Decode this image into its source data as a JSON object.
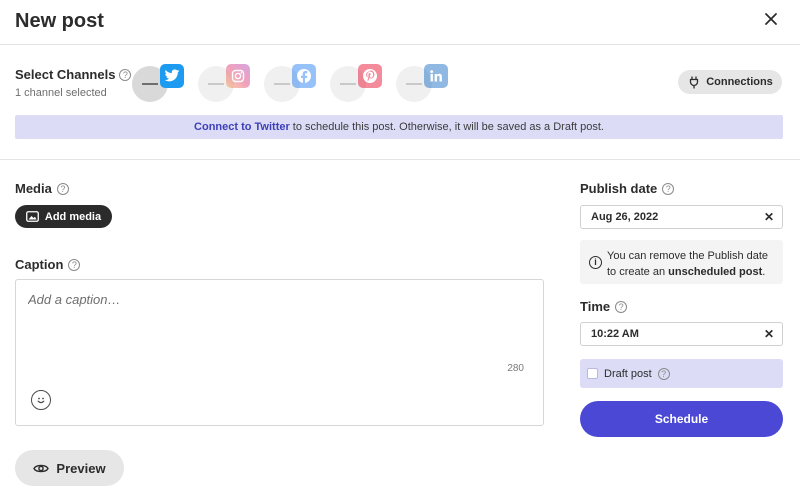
{
  "header": {
    "title": "New post",
    "close_icon": "close-icon"
  },
  "channels": {
    "label": "Select Channels",
    "subtitle": "1 channel selected",
    "items": [
      {
        "name": "Twitter",
        "icon": "twitter-icon",
        "color": "#1d9bf0",
        "selected": true
      },
      {
        "name": "Instagram",
        "icon": "instagram-icon",
        "color": "#e1306c",
        "selected": false
      },
      {
        "name": "Facebook",
        "icon": "facebook-icon",
        "color": "#1877f2",
        "selected": false
      },
      {
        "name": "Pinterest",
        "icon": "pinterest-icon",
        "color": "#e60023",
        "selected": false
      },
      {
        "name": "LinkedIn",
        "icon": "linkedin-icon",
        "color": "#0a66c2",
        "selected": false
      }
    ],
    "connections_label": "Connections",
    "notice": {
      "link_text": "Connect to Twitter",
      "text": "to schedule this post. Otherwise, it will be saved as a Draft post."
    }
  },
  "media": {
    "label": "Media",
    "add_label": "Add media"
  },
  "caption": {
    "label": "Caption",
    "placeholder": "Add a caption…",
    "char_count": "280"
  },
  "preview": {
    "label": "Preview"
  },
  "publish": {
    "label": "Publish date",
    "date_value": "Aug 26, 2022",
    "info_text_1": "You can remove the Publish date to create an",
    "info_bold": "unscheduled post",
    "info_text_2": "."
  },
  "time": {
    "label": "Time",
    "value": "10:22 AM"
  },
  "draft": {
    "label": "Draft post",
    "checked": false
  },
  "schedule": {
    "label": "Schedule"
  },
  "colors": {
    "accent": "#4b48d6",
    "notice_bg": "#dcdcf7",
    "link": "#3d3fb7"
  }
}
